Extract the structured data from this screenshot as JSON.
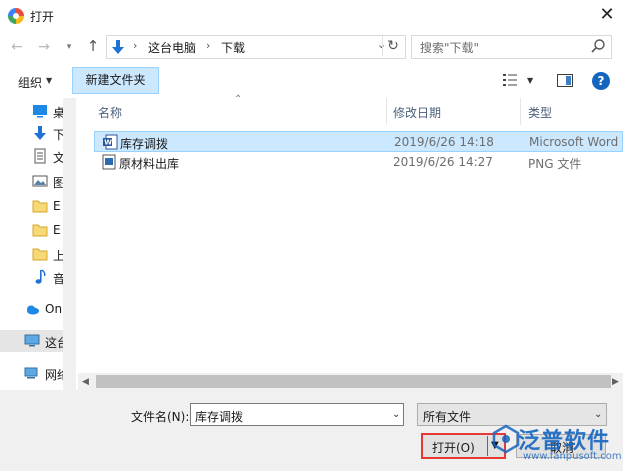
{
  "window": {
    "title": "打开"
  },
  "address": {
    "crumbs": [
      "这台电脑",
      "下载"
    ]
  },
  "search": {
    "placeholder": "搜索\"下载\""
  },
  "toolbar": {
    "organize_label": "组织",
    "new_folder_label": "新建文件夹"
  },
  "nav_pane": {
    "items": [
      {
        "label": "桌",
        "icon": "desktop-icon"
      },
      {
        "label": "下",
        "icon": "download-icon"
      },
      {
        "label": "文",
        "icon": "document-icon"
      },
      {
        "label": "图",
        "icon": "picture-icon"
      },
      {
        "label": "E",
        "icon": "folder-icon"
      },
      {
        "label": "E",
        "icon": "folder-icon"
      },
      {
        "label": "上",
        "icon": "folder-icon"
      },
      {
        "label": "音",
        "icon": "music-icon"
      },
      {
        "label": "On",
        "icon": "onedrive-icon"
      },
      {
        "label": "这台",
        "icon": "computer-icon"
      },
      {
        "label": "网络",
        "icon": "network-icon"
      }
    ]
  },
  "columns": {
    "name": "名称",
    "date": "修改日期",
    "type": "类型"
  },
  "files": [
    {
      "name": "库存调拨",
      "date": "2019/6/26 14:18",
      "type": "Microsoft Word",
      "icon": "word-doc-icon",
      "selected": true
    },
    {
      "name": "原材料出库",
      "date": "2019/6/26 14:27",
      "type": "PNG 文件",
      "icon": "png-file-icon",
      "selected": false
    }
  ],
  "bottom": {
    "filename_label": "文件名(N):",
    "filename_value": "库存调拨",
    "filetype_value": "所有文件",
    "open_label": "打开(O)",
    "cancel_label": "取消"
  },
  "watermark": {
    "brand": "泛普软件",
    "url": "www.fanpusoft.com"
  },
  "colors": {
    "selection": "#cce8ff",
    "accent": "#1565c0",
    "highlight_border": "#e53935"
  }
}
